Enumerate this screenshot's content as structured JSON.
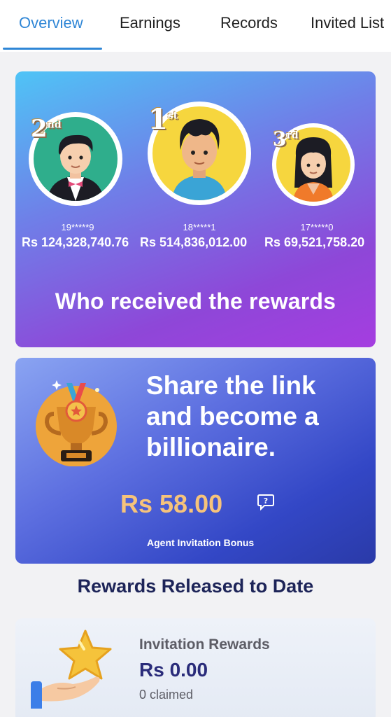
{
  "tabs": [
    {
      "label": "Overview",
      "active": true
    },
    {
      "label": "Earnings",
      "active": false
    },
    {
      "label": "Records",
      "active": false
    },
    {
      "label": "Invited List",
      "active": false
    }
  ],
  "leaderboard": {
    "winners": [
      {
        "rank_num": "2",
        "rank_suffix": "nd",
        "id": "19*****9",
        "amount": "Rs  124,328,740.76",
        "avatar": "boy-tuxedo-avatar"
      },
      {
        "rank_num": "1",
        "rank_suffix": "st",
        "id": "18*****1",
        "amount": "Rs  514,836,012.00",
        "avatar": "boy-blue-shirt-avatar"
      },
      {
        "rank_num": "3",
        "rank_suffix": "rd",
        "id": "17*****0",
        "amount": "Rs  69,521,758.20",
        "avatar": "girl-avatar"
      }
    ],
    "title": "Who received the rewards"
  },
  "share": {
    "headline": "Share the link and become a billionaire.",
    "bonus_amount": "Rs  58.00",
    "bonus_label": "Agent Invitation Bonus",
    "icon": "help-chat-icon"
  },
  "released": {
    "title": "Rewards Released to Date",
    "card": {
      "name": "Invitation Rewards",
      "amount": "Rs  0.00",
      "claimed": "0 claimed"
    }
  },
  "colors": {
    "accent": "#2f86d6",
    "bonus": "#f6c37b",
    "heading": "#1d2458"
  }
}
